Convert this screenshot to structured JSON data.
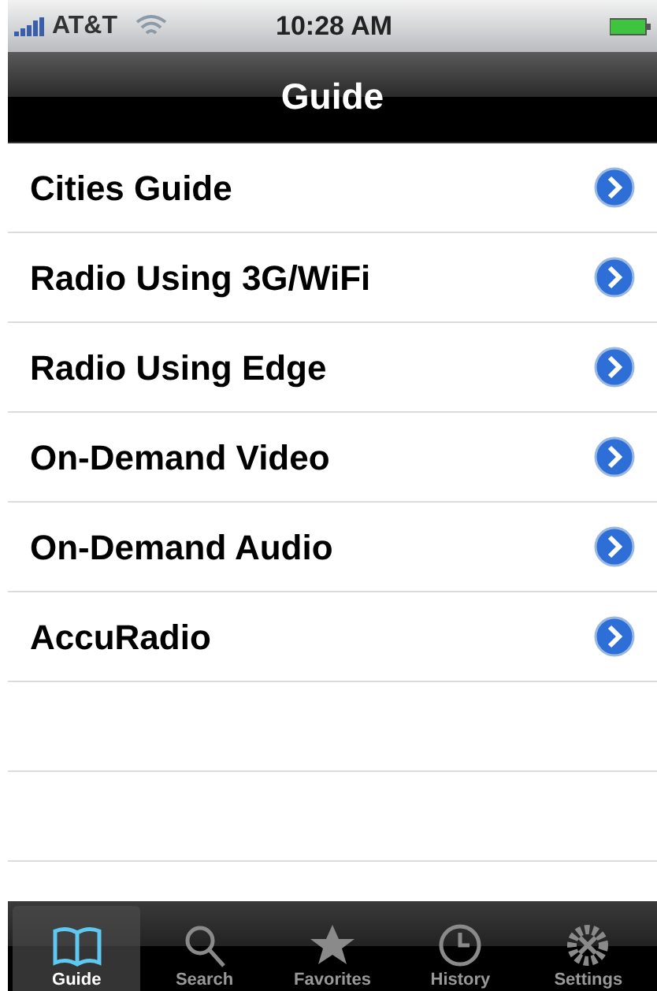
{
  "status_bar": {
    "carrier": "AT&T",
    "time": "10:28 AM"
  },
  "nav_bar": {
    "title": "Guide"
  },
  "items": [
    {
      "label": "Cities Guide"
    },
    {
      "label": "Radio Using 3G/WiFi"
    },
    {
      "label": "Radio Using Edge"
    },
    {
      "label": "On-Demand Video"
    },
    {
      "label": "On-Demand Audio"
    },
    {
      "label": "AccuRadio"
    }
  ],
  "tabs": [
    {
      "label": "Guide",
      "kind": "book",
      "selected": true
    },
    {
      "label": "Search",
      "kind": "search",
      "selected": false
    },
    {
      "label": "Favorites",
      "kind": "star",
      "selected": false
    },
    {
      "label": "History",
      "kind": "clock",
      "selected": false
    },
    {
      "label": "Settings",
      "kind": "gear",
      "selected": false
    }
  ]
}
